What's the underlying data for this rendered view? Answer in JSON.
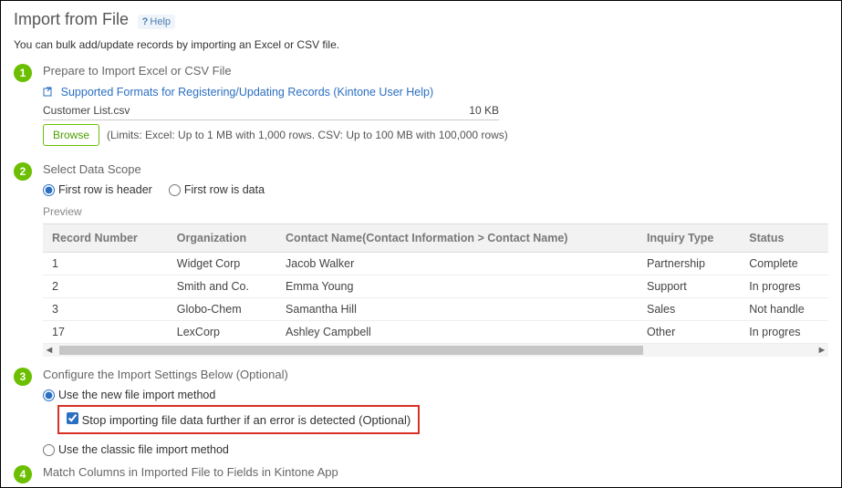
{
  "header": {
    "title": "Import from File",
    "help_icon": "?",
    "help_label": "Help"
  },
  "subtitle": "You can bulk add/update records by importing an Excel or CSV file.",
  "steps": {
    "s1": {
      "num": "1",
      "title": "Prepare to Import Excel or CSV File",
      "link_text": "Supported Formats for Registering/Updating Records (Kintone User Help)",
      "file_name": "Customer List.csv",
      "file_size": "10 KB",
      "browse_label": "Browse",
      "limits": "(Limits: Excel: Up to 1 MB with 1,000 rows. CSV: Up to 100 MB with 100,000 rows)"
    },
    "s2": {
      "num": "2",
      "title": "Select Data Scope",
      "radio_header": "First row is header",
      "radio_data": "First row is data",
      "preview_label": "Preview",
      "columns": [
        "Record Number",
        "Organization",
        "Contact Name(Contact Information > Contact Name)",
        "Inquiry Type",
        "Status"
      ],
      "rows": [
        {
          "c0": "1",
          "c1": "Widget Corp",
          "c2": "Jacob Walker",
          "c3": "Partnership",
          "c4": "Complete"
        },
        {
          "c0": "2",
          "c1": "Smith and Co.",
          "c2": "Emma Young",
          "c3": "Support",
          "c4": "In progres"
        },
        {
          "c0": "3",
          "c1": "Globo-Chem",
          "c2": "Samantha Hill",
          "c3": "Sales",
          "c4": "Not handle"
        },
        {
          "c0": "17",
          "c1": "LexCorp",
          "c2": "Ashley Campbell",
          "c3": "Other",
          "c4": "In progres"
        }
      ]
    },
    "s3": {
      "num": "3",
      "title": "Configure the Import Settings Below (Optional)",
      "opt_new": "Use the new file import method",
      "opt_stop": "Stop importing file data further if an error is detected (Optional)",
      "opt_classic": "Use the classic file import method"
    },
    "s4": {
      "num": "4",
      "title": "Match Columns in Imported File to Fields in Kintone App"
    }
  }
}
